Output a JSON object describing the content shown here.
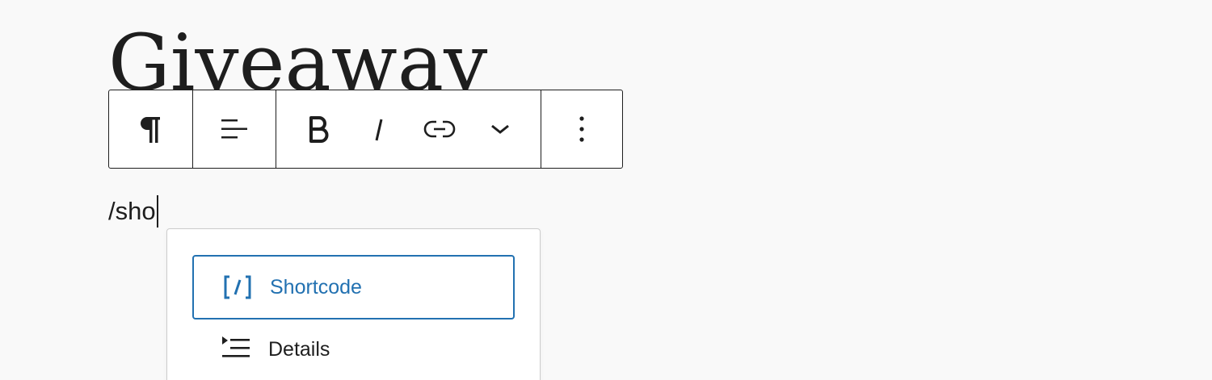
{
  "editor": {
    "title": "Giveaway",
    "typed_text": "/sho"
  },
  "toolbar": {
    "groups": [
      {
        "name": "block-type",
        "icons": [
          "paragraph-icon"
        ]
      },
      {
        "name": "alignment",
        "icons": [
          "align-left-icon"
        ]
      },
      {
        "name": "formatting",
        "icons": [
          "bold-icon",
          "italic-icon",
          "link-icon",
          "chevron-down-icon"
        ]
      },
      {
        "name": "more",
        "icons": [
          "more-vertical-icon"
        ]
      }
    ]
  },
  "inserter": {
    "items": [
      {
        "label": "Shortcode",
        "icon": "shortcode-icon",
        "selected": true
      },
      {
        "label": "Details",
        "icon": "details-icon",
        "selected": false
      }
    ]
  },
  "colors": {
    "text": "#1e1e1e",
    "accent": "#2271b1",
    "background": "#f9f9f9",
    "popover_border": "#cccccc"
  }
}
